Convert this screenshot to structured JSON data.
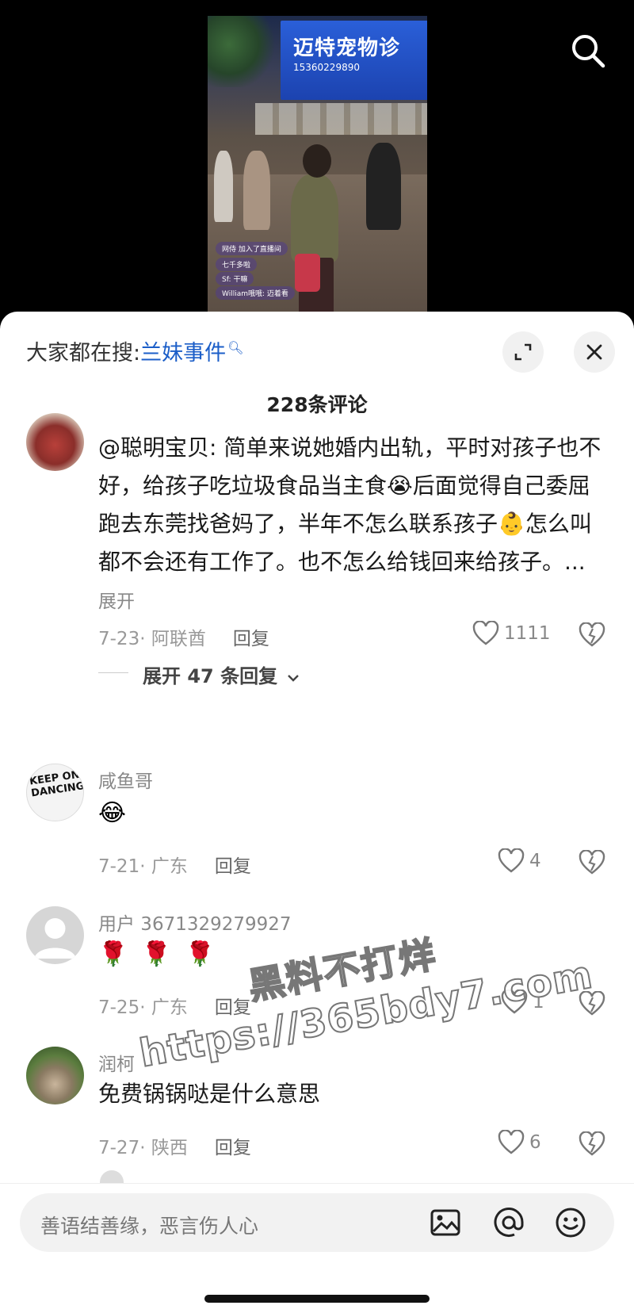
{
  "video": {
    "sign_title": "迈特宠物诊",
    "sign_phone": "15360229890",
    "overlay_lines": [
      "网侍 加入了直播间",
      "七千多啦",
      "Sf: 干嘛",
      "William哦哦: 迈着看"
    ]
  },
  "sheet": {
    "search_prefix": "大家都在搜:",
    "search_term": "兰妹事件",
    "comment_count": "228条评论"
  },
  "comments": [
    {
      "text": "@聪明宝贝: 简单来说她婚内出轨，平时对孩子也不好，给孩子吃垃圾食品当主食😭后面觉得自己委屈跑去东莞找爸妈了，半年不怎么联系孩子👶怎么叫都不会还有工作了。也不怎么给钱回来给孩子。...",
      "more_label": "展开",
      "date_location": "7-23· 阿联酋",
      "reply_label": "回复",
      "likes": "1111",
      "expand_replies": "展开 47 条回复"
    },
    {
      "name": "咸鱼哥",
      "text": "😂",
      "date_location": "7-21· 广东",
      "reply_label": "回复",
      "likes": "4",
      "avatar_text": "KEEP ON DANCING"
    },
    {
      "name": "用户 3671329279927",
      "text": "🌹 🌹 🌹",
      "date_location": "7-25· 广东",
      "reply_label": "回复",
      "likes": "1"
    },
    {
      "name": "润柯",
      "text": "免费锅锅哒是什么意思",
      "date_location": "7-27· 陕西",
      "reply_label": "回复",
      "likes": "6"
    }
  ],
  "watermark": {
    "line1": "黑料不打烊",
    "line2": "https://365bdy7.com"
  },
  "input": {
    "placeholder": "善语结善缘，恶言伤人心"
  },
  "icons": [
    "search-icon",
    "expand-icon",
    "close-icon",
    "heart-icon",
    "dislike-icon",
    "chevron-down-icon",
    "image-icon",
    "at-icon",
    "emoji-icon"
  ],
  "colors": {
    "link_blue": "#1b5ec8",
    "meta_gray": "#999999"
  }
}
